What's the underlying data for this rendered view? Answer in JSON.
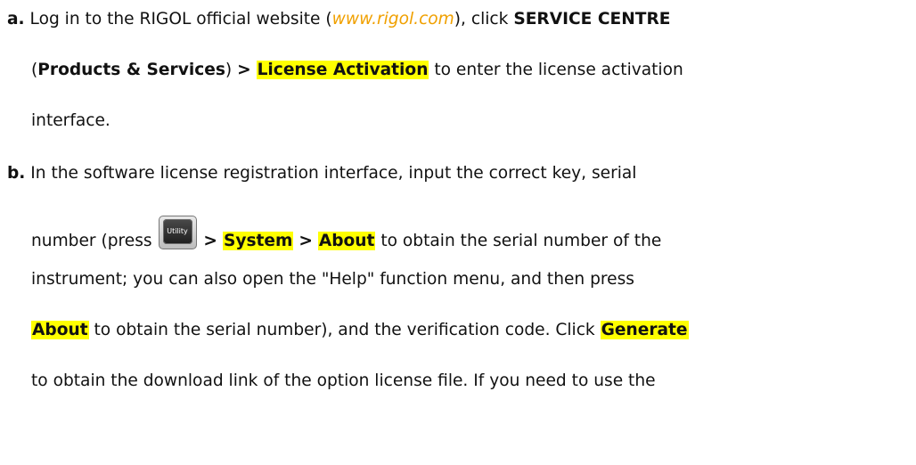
{
  "steps": {
    "a": {
      "marker": "a.",
      "l1_t1": "Log in to the RIGOL official website (",
      "l1_link": "www.rigol.com",
      "l1_t2": "), click ",
      "l1_b1": "SERVICE CENTRE",
      "l2_t1": "(",
      "l2_b1": "Products & Services",
      "l2_t2": ") ",
      "l2_sep": ">",
      "l2_hl1": "License Activation",
      "l2_t3": " to enter the license activation",
      "l3_t1": "interface."
    },
    "b": {
      "marker": "b.",
      "l1_t1": "In the software license registration interface, input the correct key, serial",
      "l2_t1": "number (press ",
      "key_label": "Utility",
      "l2_sep1": ">",
      "l2_hl1": "System",
      "l2_sep2": ">",
      "l2_hl2": "About",
      "l2_t2": " to obtain the serial number of the",
      "l3_t1": "instrument; you can also open the \"Help\" function menu, and then press",
      "l4_hl1": "About",
      "l4_t1": " to obtain the serial number), and the verification code. Click ",
      "l4_hl2": "Generate",
      "l5_t1": "to obtain the download link of the option license file. If you need to use the"
    }
  },
  "colors": {
    "highlight": "#ffff00",
    "link": "#f0a000",
    "text": "#111111"
  },
  "icons": {
    "utility_key": "utility-key-icon"
  }
}
